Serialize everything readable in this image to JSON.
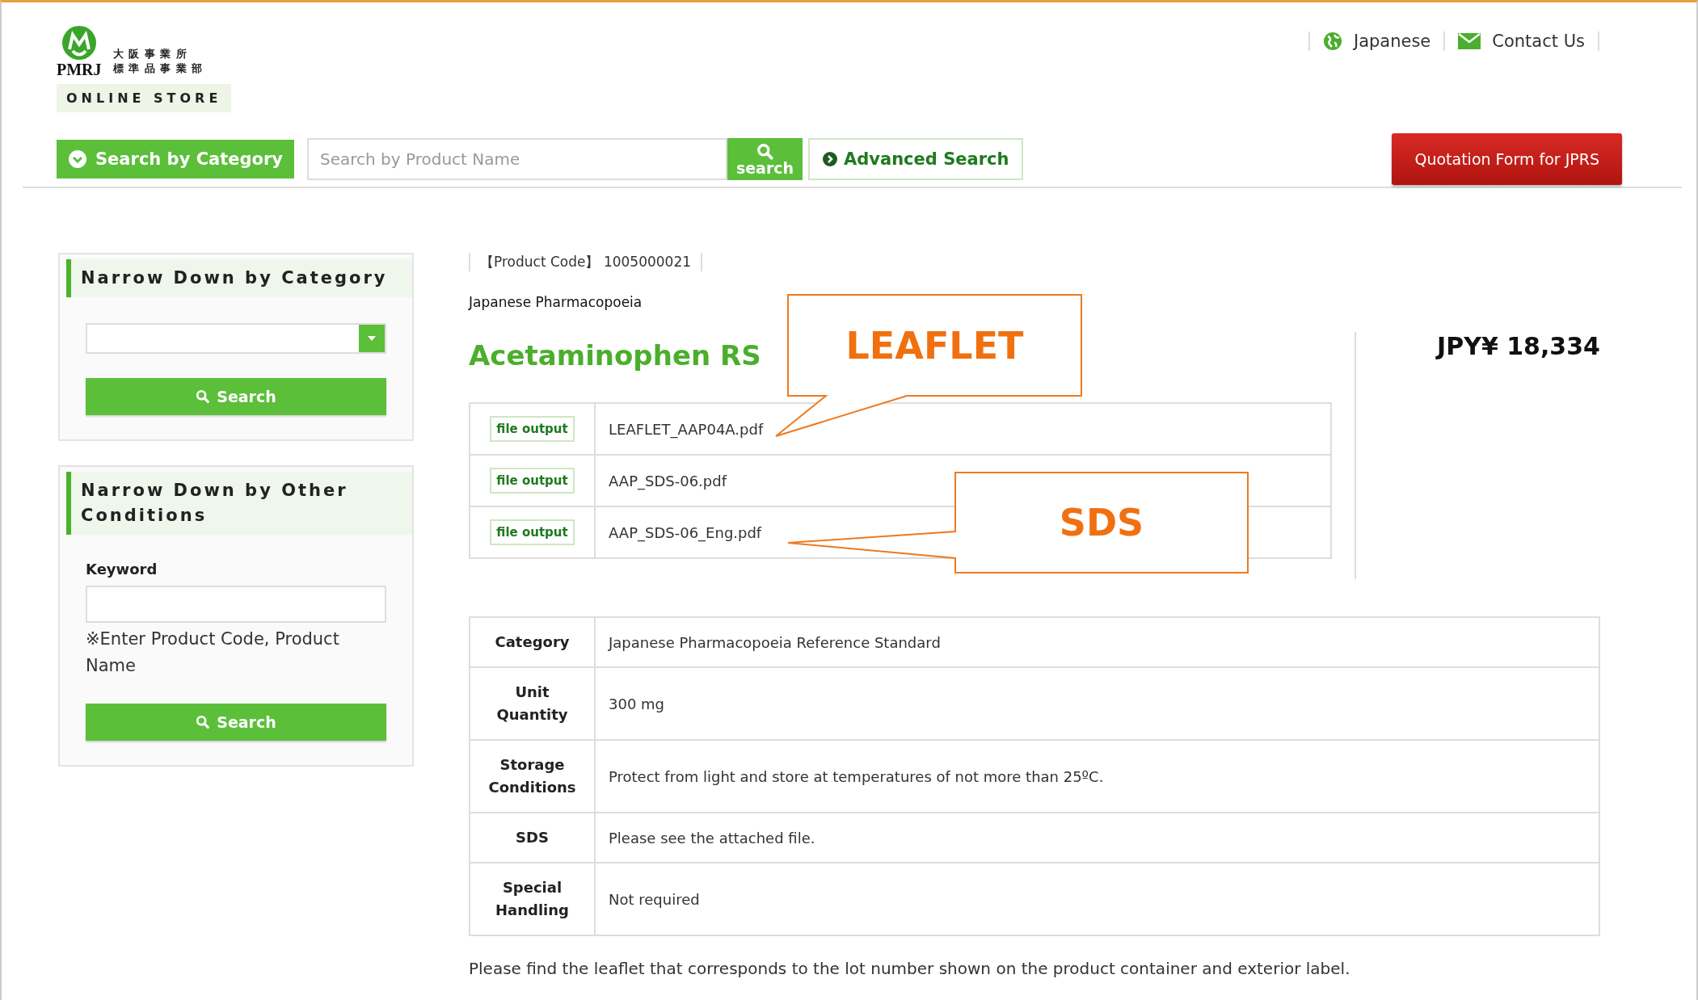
{
  "logo": {
    "mark": "PMRJ",
    "lines": [
      "大 阪 事 業 所",
      "標 準 品 事 業 部"
    ],
    "store": "ONLINE STORE"
  },
  "top_links": [
    {
      "kind": "globe",
      "label": "Japanese"
    },
    {
      "kind": "mail",
      "label": "Contact Us"
    }
  ],
  "search_bar": {
    "category_button": "Search by Category",
    "placeholder": "Search by Product Name",
    "search_button": "search",
    "advanced_button": "Advanced Search",
    "quotation_button": "Quotation Form for JPRS"
  },
  "sidebar": [
    {
      "kind": "category",
      "title": "Narrow Down by Category",
      "button": "Search"
    },
    {
      "kind": "keyword",
      "title": "Narrow Down by Other Conditions",
      "label": "Keyword",
      "hint": "※Enter Product Code, Product Name",
      "button": "Search"
    }
  ],
  "product": {
    "code": "【Product Code】 1005000021",
    "series": "Japanese Pharmacopoeia",
    "name": "Acetaminophen RS",
    "price": "JPY¥ 18,334",
    "files": [
      {
        "button": "file output",
        "name": "LEAFLET_AAP04A.pdf"
      },
      {
        "button": "file output",
        "name": "AAP_SDS-06.pdf"
      },
      {
        "button": "file output",
        "name": "AAP_SDS-06_Eng.pdf"
      }
    ],
    "specs": [
      {
        "label": "Category",
        "value": "Japanese Pharmacopoeia Reference Standard"
      },
      {
        "label": "Unit Quantity",
        "value": "300 mg"
      },
      {
        "label": "Storage Conditions",
        "value": "Protect from light and store at temperatures of not more than 25ºC."
      },
      {
        "label": "SDS",
        "value": "Please see the attached file."
      },
      {
        "label": "Special Handling",
        "value": "Not required"
      }
    ],
    "note": "Please find the leaflet that corresponds to the lot number shown on the product container and exterior label."
  },
  "callouts": [
    {
      "text": "LEAFLET"
    },
    {
      "text": "SDS"
    }
  ]
}
